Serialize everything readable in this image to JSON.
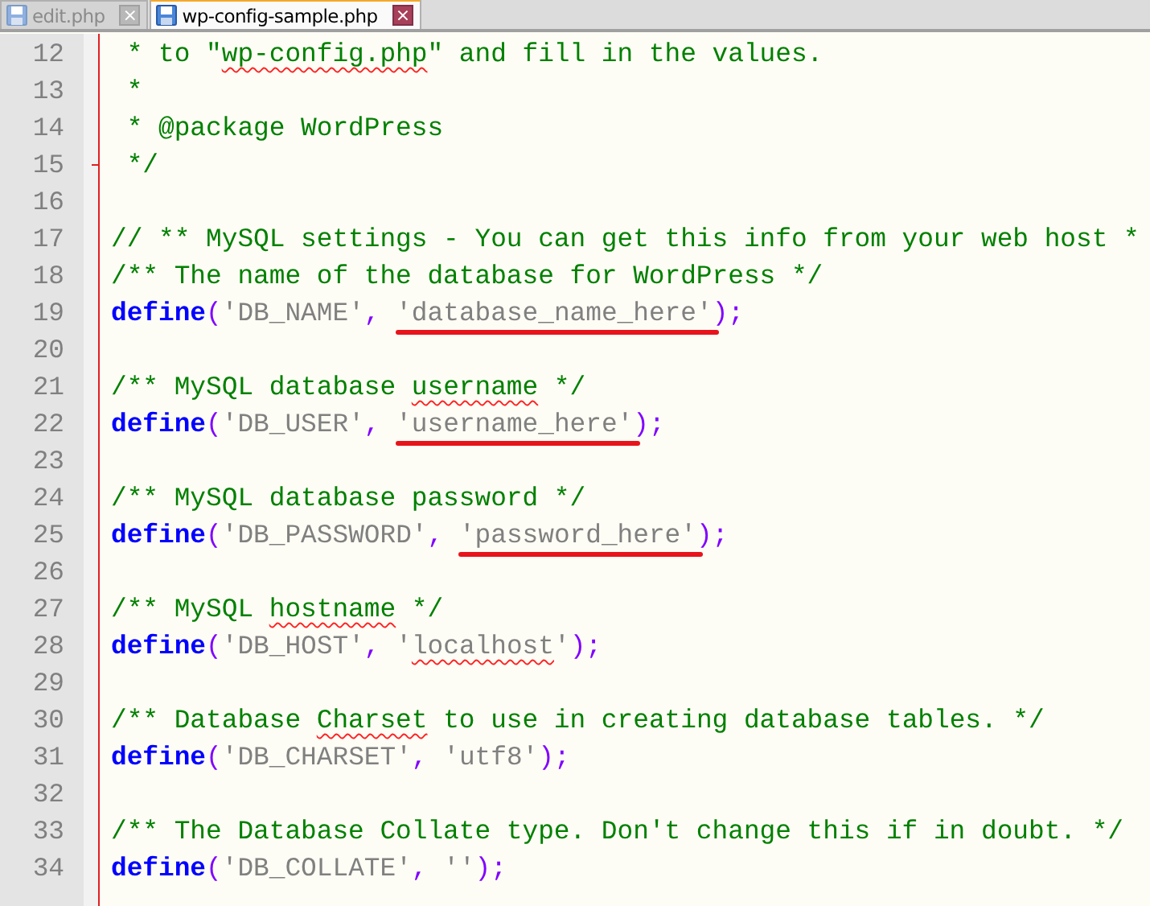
{
  "tabs": [
    {
      "label": "edit.php",
      "selected": false,
      "close": "×"
    },
    {
      "label": "wp-config-sample.php",
      "selected": true,
      "close": "×"
    }
  ],
  "lines": [
    {
      "number": "12",
      "tokens": [
        {
          "kind": "comment",
          "text": " * to \""
        },
        {
          "kind": "comment",
          "text": "wp-config.php",
          "misspelled": true
        },
        {
          "kind": "comment",
          "text": "\" and fill in the values."
        }
      ]
    },
    {
      "number": "13",
      "tokens": [
        {
          "kind": "comment",
          "text": " *"
        }
      ]
    },
    {
      "number": "14",
      "tokens": [
        {
          "kind": "comment",
          "text": " * @package WordPress"
        }
      ]
    },
    {
      "number": "15",
      "fold_end": true,
      "tokens": [
        {
          "kind": "comment",
          "text": " */"
        }
      ]
    },
    {
      "number": "16"
    },
    {
      "number": "17",
      "tokens": [
        {
          "kind": "comment",
          "text": "// ** MySQL settings - You can get this info from your web host *"
        }
      ]
    },
    {
      "number": "18",
      "tokens": [
        {
          "kind": "comment",
          "text": "/** The name of the database for WordPress */"
        }
      ]
    },
    {
      "number": "19",
      "tokens": [
        {
          "kind": "keyword",
          "text": "define"
        },
        {
          "kind": "operator",
          "text": "("
        },
        {
          "kind": "string",
          "text": "'DB_NAME'"
        },
        {
          "kind": "operator",
          "text": ", "
        },
        {
          "kind": "string",
          "text": "'database_name_here'",
          "marked": true
        },
        {
          "kind": "operator",
          "text": ");"
        }
      ]
    },
    {
      "number": "20"
    },
    {
      "number": "21",
      "tokens": [
        {
          "kind": "comment",
          "text": "/** MySQL database "
        },
        {
          "kind": "comment",
          "text": "username",
          "misspelled": true
        },
        {
          "kind": "comment",
          "text": " */"
        }
      ]
    },
    {
      "number": "22",
      "tokens": [
        {
          "kind": "keyword",
          "text": "define"
        },
        {
          "kind": "operator",
          "text": "("
        },
        {
          "kind": "string",
          "text": "'DB_USER'"
        },
        {
          "kind": "operator",
          "text": ", "
        },
        {
          "kind": "string",
          "text": "'username_here'",
          "marked": true
        },
        {
          "kind": "operator",
          "text": ");"
        }
      ]
    },
    {
      "number": "23"
    },
    {
      "number": "24",
      "tokens": [
        {
          "kind": "comment",
          "text": "/** MySQL database password */"
        }
      ]
    },
    {
      "number": "25",
      "tokens": [
        {
          "kind": "keyword",
          "text": "define"
        },
        {
          "kind": "operator",
          "text": "("
        },
        {
          "kind": "string",
          "text": "'DB_PASSWORD'"
        },
        {
          "kind": "operator",
          "text": ", "
        },
        {
          "kind": "string",
          "text": "'password_here'",
          "marked": true
        },
        {
          "kind": "operator",
          "text": ");"
        }
      ]
    },
    {
      "number": "26"
    },
    {
      "number": "27",
      "tokens": [
        {
          "kind": "comment",
          "text": "/** MySQL "
        },
        {
          "kind": "comment",
          "text": "hostname",
          "misspelled": true
        },
        {
          "kind": "comment",
          "text": " */"
        }
      ]
    },
    {
      "number": "28",
      "tokens": [
        {
          "kind": "keyword",
          "text": "define"
        },
        {
          "kind": "operator",
          "text": "("
        },
        {
          "kind": "string",
          "text": "'DB_HOST'"
        },
        {
          "kind": "operator",
          "text": ", "
        },
        {
          "kind": "string",
          "text": "'"
        },
        {
          "kind": "string",
          "text": "localhost",
          "misspelled": true
        },
        {
          "kind": "string",
          "text": "'"
        },
        {
          "kind": "operator",
          "text": ");"
        }
      ]
    },
    {
      "number": "29"
    },
    {
      "number": "30",
      "tokens": [
        {
          "kind": "comment",
          "text": "/** Database "
        },
        {
          "kind": "comment",
          "text": "Charset",
          "misspelled": true
        },
        {
          "kind": "comment",
          "text": " to use in creating database tables. */"
        }
      ]
    },
    {
      "number": "31",
      "tokens": [
        {
          "kind": "keyword",
          "text": "define"
        },
        {
          "kind": "operator",
          "text": "("
        },
        {
          "kind": "string",
          "text": "'DB_CHARSET'"
        },
        {
          "kind": "operator",
          "text": ", "
        },
        {
          "kind": "string",
          "text": "'utf8'"
        },
        {
          "kind": "operator",
          "text": ");"
        }
      ]
    },
    {
      "number": "32"
    },
    {
      "number": "33",
      "tokens": [
        {
          "kind": "comment",
          "text": "/** The Database Collate type. Don't change this if in doubt. */"
        }
      ]
    },
    {
      "number": "34",
      "tokens": [
        {
          "kind": "keyword",
          "text": "define"
        },
        {
          "kind": "operator",
          "text": "("
        },
        {
          "kind": "string",
          "text": "'DB_COLLATE'"
        },
        {
          "kind": "operator",
          "text": ", "
        },
        {
          "kind": "string",
          "text": "''"
        },
        {
          "kind": "operator",
          "text": ");"
        }
      ]
    }
  ]
}
